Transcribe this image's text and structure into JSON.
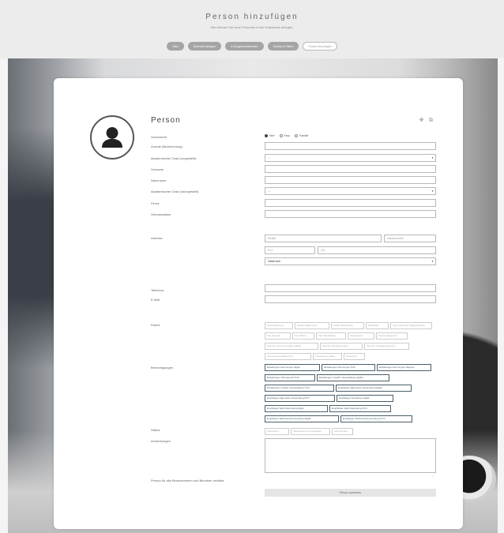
{
  "header": {
    "title": "Person hinzufügen",
    "subtitle": "Hier können Sie neue Personen in der Datenbank anlegen.",
    "steps": [
      {
        "label": "Start",
        "outline": false
      },
      {
        "label": "Übersicht anlegen",
        "outline": false
      },
      {
        "label": "in Gruppenmitarbeiten",
        "outline": false
      },
      {
        "label": "Suchen & Filtern",
        "outline": false
      },
      {
        "label": "Person hinzufügen",
        "outline": true
      }
    ]
  },
  "form": {
    "title": "Person",
    "gender": {
      "label": "Geschlecht",
      "options": [
        "Herr",
        "Frau",
        "Familie"
      ],
      "selected": 0
    },
    "fields": [
      {
        "label": "Anrede (Bezeichnung)",
        "value": "",
        "type": "text"
      },
      {
        "label": "Akademischer Grad (vorgestellt)",
        "value": "---",
        "type": "select"
      },
      {
        "label": "Vorname",
        "value": "",
        "type": "text"
      },
      {
        "label": "Nachname",
        "value": "",
        "type": "text"
      },
      {
        "label": "Akademischer Grad (nachgestellt)",
        "value": "---",
        "type": "select"
      },
      {
        "label": "Firma",
        "value": "",
        "type": "text"
      },
      {
        "label": "Geburtsdatum",
        "value": "",
        "type": "text"
      }
    ],
    "address": {
      "label": "Adresse",
      "street_placeholder": "Straße",
      "number_placeholder": "Hausnummer",
      "zip_placeholder": "PLZ",
      "city_placeholder": "Ort",
      "country": "Österreich"
    },
    "phone_label": "Telefonnr.",
    "email_label": "E-Mail",
    "rubrics": {
      "label": "Rubrik",
      "items": [
        "Generalsponsor",
        "Medien (allgemein)",
        "Politik (Österreich)",
        "Wirtschaft",
        "Sport (Vertreter Meggenhofen)",
        "Fan (Vienna)",
        "Fan (Wien)",
        "Fan (Meldeliste)",
        "Spielgruppe",
        "Verein (allgemein)",
        "Sponsor (Gönnervorgabe dabei)",
        "Sponsor (Hauptsponsor)",
        "Sponsor (Vorlagensponsor)",
        "Investorenvorgabenraum",
        "Investorenvorgabe",
        "Investoren"
      ]
    },
    "permissions": {
      "label": "Berechtigungen",
      "items": [
        "Einladungen Nennungen digital",
        "Einladungen Nennungen Print",
        "Einladungen Nennungen Mappen",
        "Einladungen Jahrespunkt Print",
        "Einladungen zusätzl. Veranstaltung digital",
        "Einladungen zusätzl. Veranstaltung Print",
        "Empfänger allgemeine Zuwendung digital",
        "Empfänger allgemeine Zuwendung Print",
        "Empfänger Newsletter digital",
        "Empfänger Sachzuwendung digital",
        "Empfänger Sachzuwendung Print",
        "Empfänger Weihnachtszuwendung digital",
        "Empfänger Weihnachtszuwendung Print"
      ]
    },
    "status": {
      "label": "Status",
      "items": [
        "Interessiert",
        "Interessiert und eingeladen",
        "Abonnement"
      ]
    },
    "notes_label": "Anmerkungen",
    "visibility_label": "Person für alle Benutzerinnen und Benutzer sichtbar",
    "save_label": "Person speichern"
  },
  "icons": {
    "avatar": "user-avatar-icon",
    "tool1": "expand-icon",
    "tool2": "clipboard-icon"
  }
}
